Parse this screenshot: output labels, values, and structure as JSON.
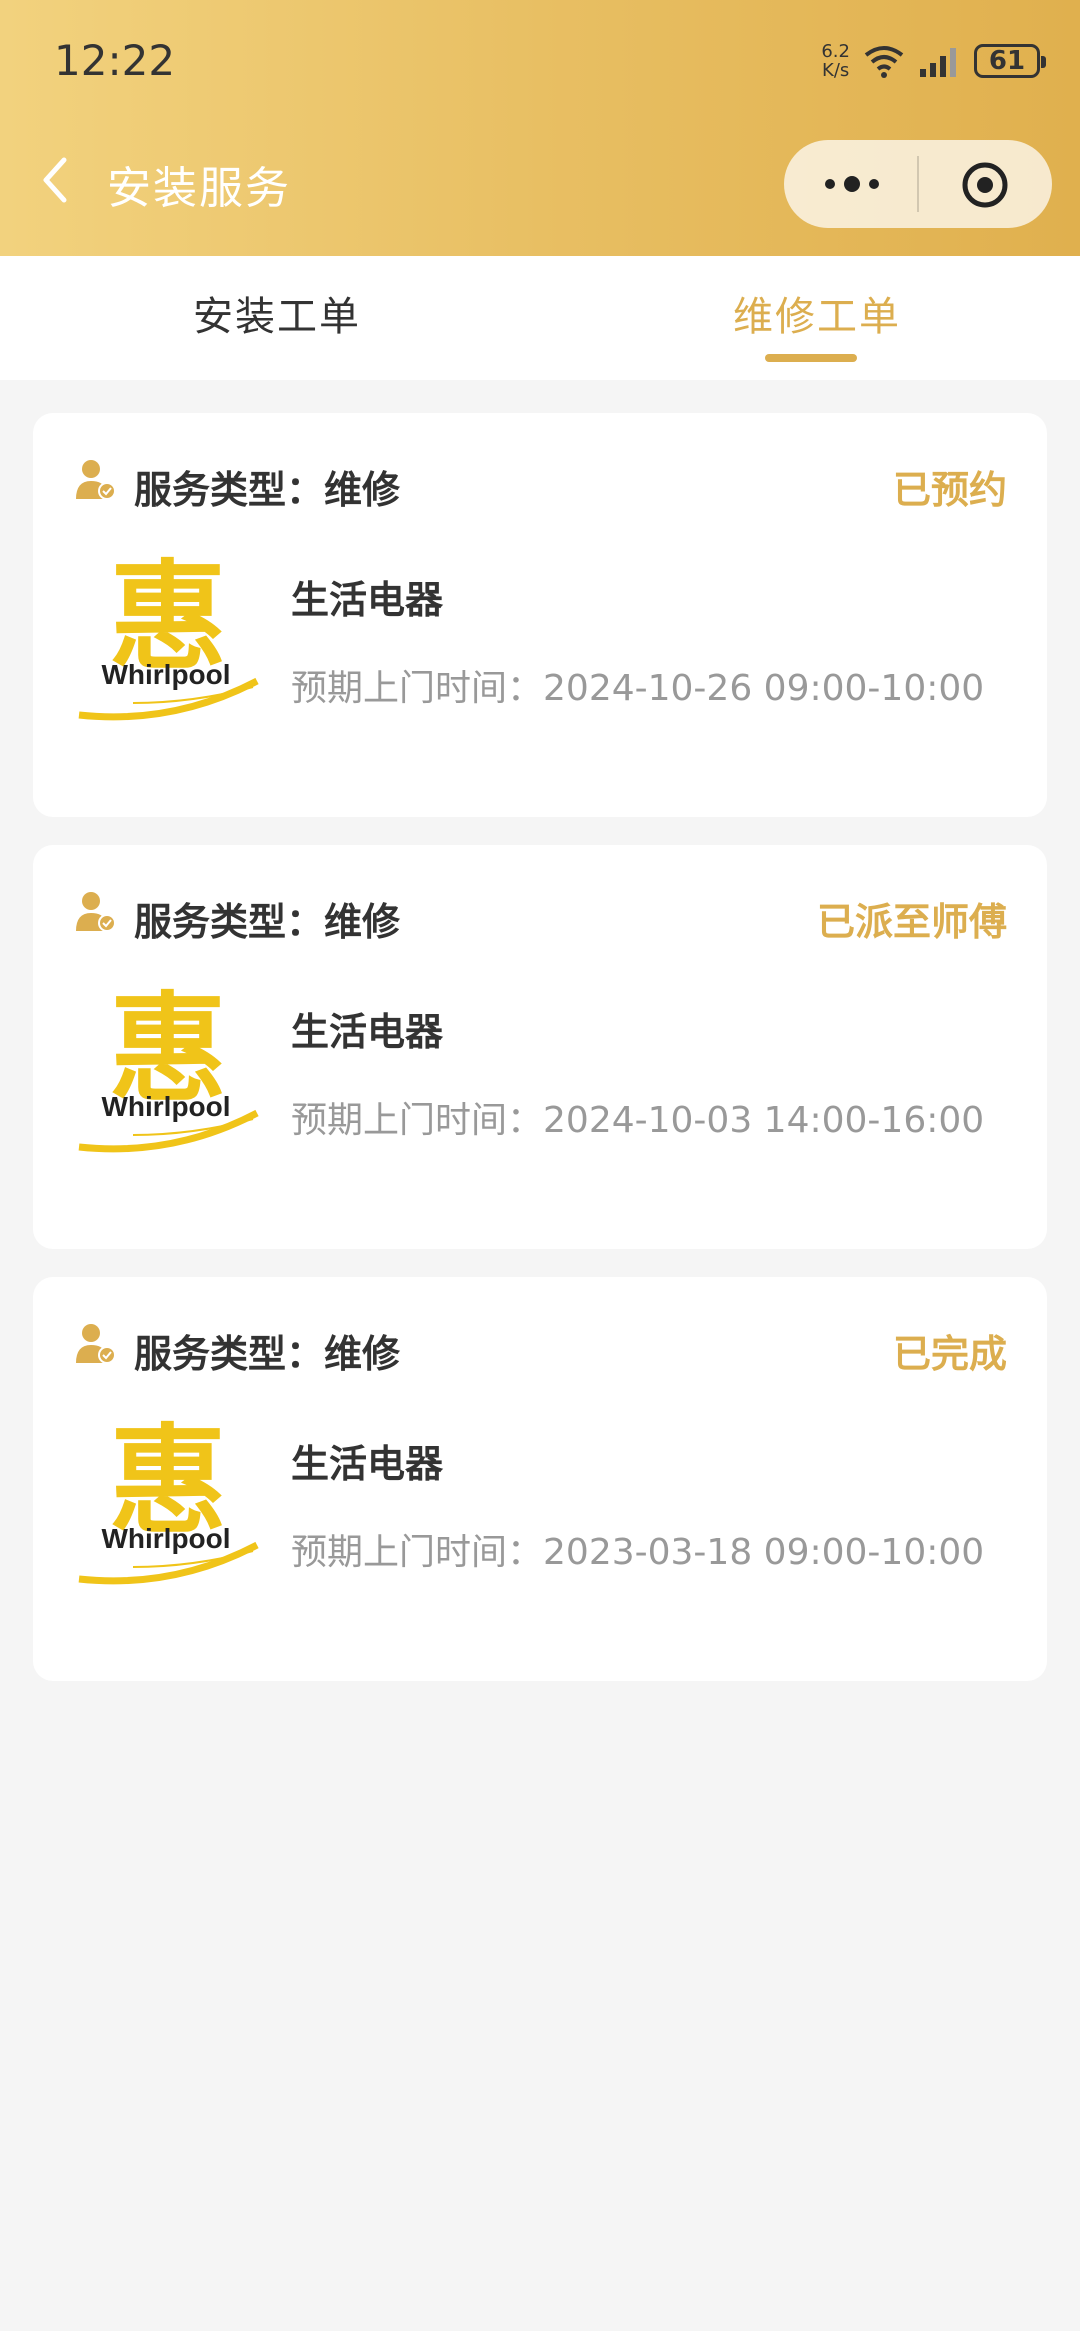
{
  "status_bar": {
    "time": "12:22",
    "net_speed_value": "6.2",
    "net_speed_unit": "K/s",
    "battery": "61"
  },
  "nav": {
    "title": "安装服务"
  },
  "tabs": [
    {
      "label": "安装工单",
      "active": false
    },
    {
      "label": "维修工单",
      "active": true
    }
  ],
  "colors": {
    "accent": "#dcae4f",
    "header_gradient_start": "#f2d27e",
    "header_gradient_end": "#e0b04e"
  },
  "orders": [
    {
      "service_type": "服务类型：维修",
      "status": "已预约",
      "logo_char": "惠",
      "logo_brand": "Whirlpool",
      "product": "生活电器",
      "time_label": "预期上门时间：",
      "time_value": "2024-10-26 09:00-10:00"
    },
    {
      "service_type": "服务类型：维修",
      "status": "已派至师傅",
      "logo_char": "惠",
      "logo_brand": "Whirlpool",
      "product": "生活电器",
      "time_label": "预期上门时间：",
      "time_value": "2024-10-03 14:00-16:00"
    },
    {
      "service_type": "服务类型：维修",
      "status": "已完成",
      "logo_char": "惠",
      "logo_brand": "Whirlpool",
      "product": "生活电器",
      "time_label": "预期上门时间：",
      "time_value": "2023-03-18 09:00-10:00"
    }
  ]
}
